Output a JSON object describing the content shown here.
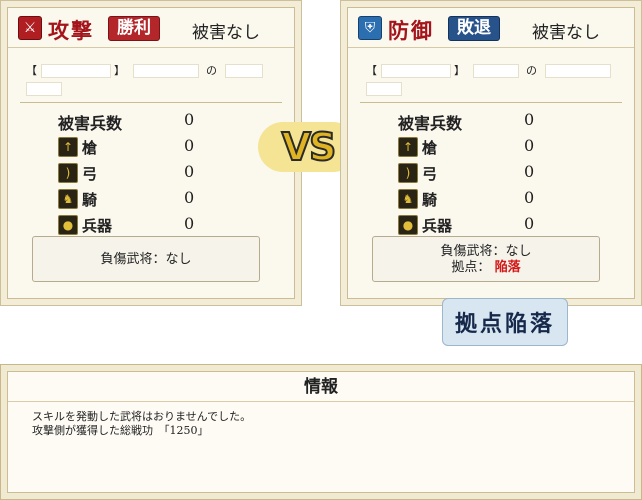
{
  "attacker": {
    "icon": "crossed-swords-icon",
    "side_label": "攻撃",
    "result": "勝利",
    "damage_status": "被害なし",
    "info_open": "【",
    "info_close": "】",
    "info_of": "の",
    "total_label": "被害兵数",
    "total_value": "0",
    "units": [
      {
        "icon": "spear-icon",
        "label": "槍",
        "value": "0"
      },
      {
        "icon": "bow-icon",
        "label": "弓",
        "value": "0"
      },
      {
        "icon": "horse-icon",
        "label": "騎",
        "value": "0"
      },
      {
        "icon": "weapon-icon",
        "label": "兵器",
        "value": "0"
      }
    ],
    "injured_label": "負傷武将：なし"
  },
  "defender": {
    "icon": "helmet-icon",
    "side_label": "防御",
    "result": "敗退",
    "damage_status": "被害なし",
    "info_open": "【",
    "info_close": "】",
    "info_of": "の",
    "total_label": "被害兵数",
    "total_value": "0",
    "units": [
      {
        "icon": "spear-icon",
        "label": "槍",
        "value": "0"
      },
      {
        "icon": "bow-icon",
        "label": "弓",
        "value": "0"
      },
      {
        "icon": "horse-icon",
        "label": "騎",
        "value": "0"
      },
      {
        "icon": "weapon-icon",
        "label": "兵器",
        "value": "0"
      }
    ],
    "injured_label": "負傷武将：なし",
    "base_label": "拠点：",
    "base_status": "陥落"
  },
  "vs_label": "VS",
  "banner_label": "拠点陥落",
  "info": {
    "title": "情報",
    "lines": [
      "スキルを発動した武将はおりませんでした。",
      "攻撃側が獲得した総戦功　「1250」"
    ]
  },
  "colors": {
    "attack_red": "#b01e22",
    "defend_blue": "#27528a",
    "fall_red": "#d21818"
  }
}
